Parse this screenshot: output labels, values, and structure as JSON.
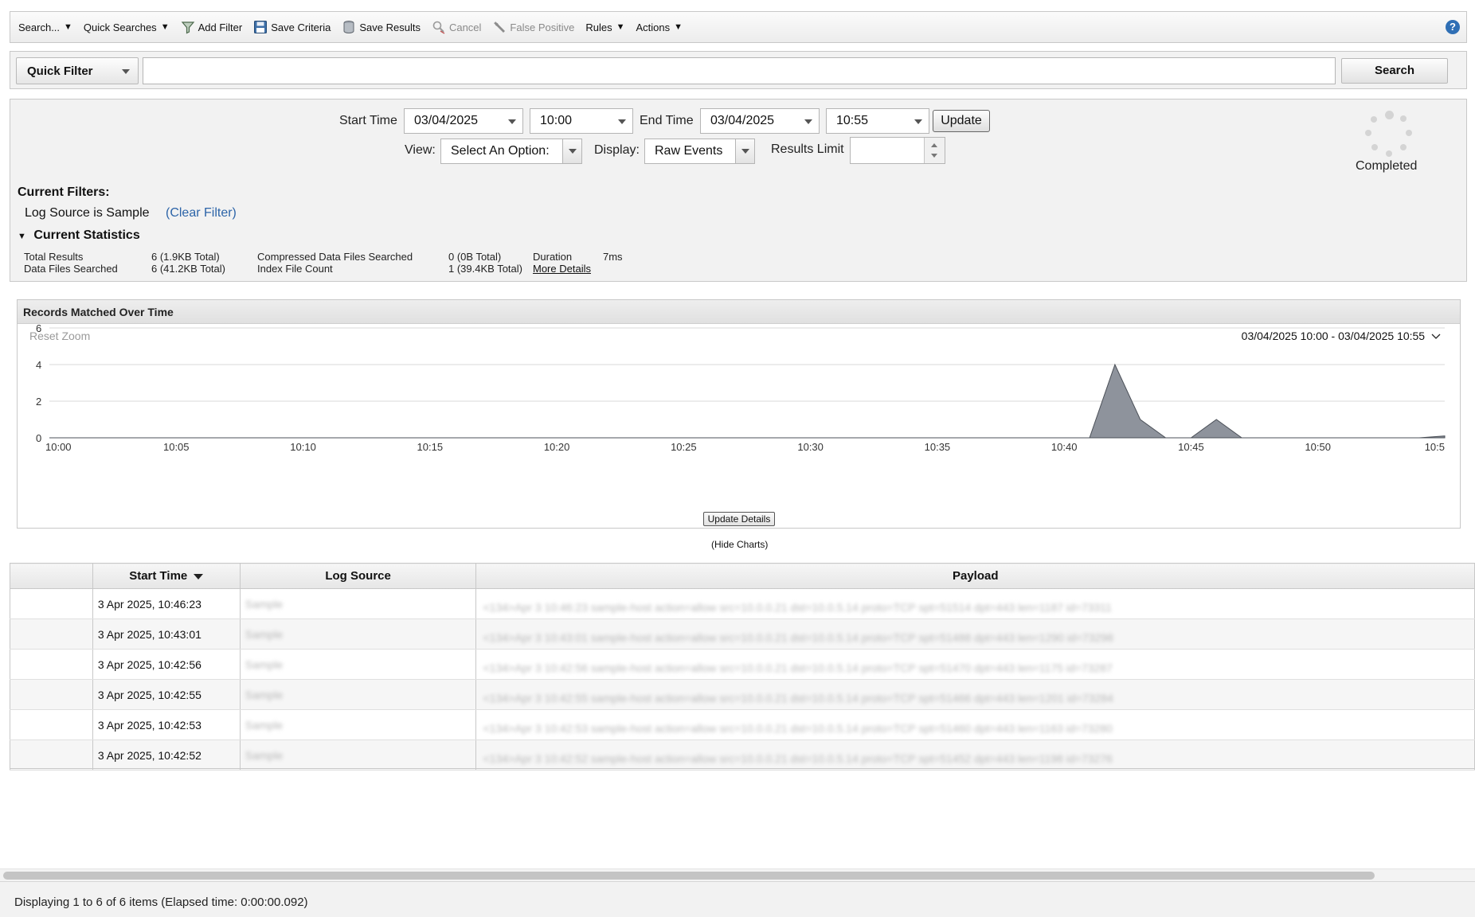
{
  "toolbar": {
    "search": "Search...",
    "quick_searches": "Quick Searches",
    "add_filter": "Add Filter",
    "save_criteria": "Save Criteria",
    "save_results": "Save Results",
    "cancel": "Cancel",
    "false_positive": "False Positive",
    "rules": "Rules",
    "actions": "Actions",
    "help": "?"
  },
  "quick_filter": {
    "selected": "Quick Filter",
    "value": "",
    "search_label": "Search"
  },
  "criteria": {
    "start_time_label": "Start Time",
    "start_date": "03/04/2025",
    "start_clock": "10:00",
    "end_time_label": "End Time",
    "end_date": "03/04/2025",
    "end_clock": "10:55",
    "update_label": "Update",
    "view_label": "View:",
    "view_value": "Select An Option:",
    "display_label": "Display:",
    "display_value": "Raw Events",
    "results_limit_label": "Results Limit",
    "results_limit_value": "",
    "status": "Completed"
  },
  "filters": {
    "title": "Current Filters:",
    "active": "Log Source is Sample",
    "clear_link": "(Clear Filter)"
  },
  "statistics": {
    "title": "Current Statistics",
    "total_results_label": "Total Results",
    "total_results_value": "6 (1.9KB Total)",
    "data_files_label": "Data Files Searched",
    "data_files_value": "6 (41.2KB Total)",
    "compressed_label": "Compressed Data Files Searched",
    "compressed_value": "0 (0B Total)",
    "index_label": "Index File Count",
    "index_value": "1 (39.4KB Total)",
    "duration_label": "Duration",
    "duration_value": "7ms",
    "more_details": "More Details"
  },
  "chart": {
    "title": "Records Matched Over Time",
    "reset_zoom": "Reset Zoom",
    "range_label": "03/04/2025 10:00 - 03/04/2025 10:55",
    "update_details": "Update Details",
    "hide_charts": "(Hide Charts)"
  },
  "chart_data": {
    "type": "area",
    "x_ticks": [
      "10:00",
      "10:05",
      "10:10",
      "10:15",
      "10:20",
      "10:25",
      "10:30",
      "10:35",
      "10:40",
      "10:45",
      "10:50",
      "10:5"
    ],
    "y_ticks": [
      0,
      2,
      4,
      6
    ],
    "ylim": [
      0,
      6
    ],
    "xlim_minutes": [
      0,
      55
    ],
    "points": [
      {
        "t": "10:00",
        "count": 0
      },
      {
        "t": "10:41",
        "count": 0
      },
      {
        "t": "10:42",
        "count": 4
      },
      {
        "t": "10:43",
        "count": 1
      },
      {
        "t": "10:44",
        "count": 0
      },
      {
        "t": "10:45",
        "count": 0
      },
      {
        "t": "10:46",
        "count": 1
      },
      {
        "t": "10:47",
        "count": 0
      },
      {
        "t": "10:54",
        "count": 0
      },
      {
        "t": "10:55",
        "count": 0.1
      }
    ],
    "fill_color": "#8e939c",
    "grid": true
  },
  "table": {
    "columns": [
      "",
      "Start Time",
      "Log Source",
      "Payload"
    ],
    "rows": [
      {
        "start_time": "3 Apr 2025, 10:46:23",
        "log_source": "Sample",
        "payload": "<134>Apr 3 10:46:23 sample-host action=allow src=10.0.0.21 dst=10.0.5.14 proto=TCP spt=51514 dpt=443 len=1187 id=73311"
      },
      {
        "start_time": "3 Apr 2025, 10:43:01",
        "log_source": "Sample",
        "payload": "<134>Apr 3 10:43:01 sample-host action=allow src=10.0.0.21 dst=10.0.5.14 proto=TCP spt=51488 dpt=443 len=1290 id=73298"
      },
      {
        "start_time": "3 Apr 2025, 10:42:56",
        "log_source": "Sample",
        "payload": "<134>Apr 3 10:42:56 sample-host action=allow src=10.0.0.21 dst=10.0.5.14 proto=TCP spt=51470 dpt=443 len=1175 id=73287"
      },
      {
        "start_time": "3 Apr 2025, 10:42:55",
        "log_source": "Sample",
        "payload": "<134>Apr 3 10:42:55 sample-host action=allow src=10.0.0.21 dst=10.0.5.14 proto=TCP spt=51466 dpt=443 len=1201 id=73284"
      },
      {
        "start_time": "3 Apr 2025, 10:42:53",
        "log_source": "Sample",
        "payload": "<134>Apr 3 10:42:53 sample-host action=allow src=10.0.0.21 dst=10.0.5.14 proto=TCP spt=51460 dpt=443 len=1163 id=73280"
      },
      {
        "start_time": "3 Apr 2025, 10:42:52",
        "log_source": "Sample",
        "payload": "<134>Apr 3 10:42:52 sample-host action=allow src=10.0.0.21 dst=10.0.5.14 proto=TCP spt=51452 dpt=443 len=1198 id=73276"
      }
    ]
  },
  "status_bar": {
    "text": "Displaying 1 to 6 of 6 items (Elapsed time: 0:00:00.092)"
  },
  "icons": {
    "add_filter": "funnel-icon",
    "save_criteria": "floppy-disk-icon",
    "save_results": "database-icon",
    "cancel": "magnifier-cancel-icon",
    "false_positive": "wrench-icon",
    "help": "help-icon",
    "status": "loading-spinner-icon"
  }
}
